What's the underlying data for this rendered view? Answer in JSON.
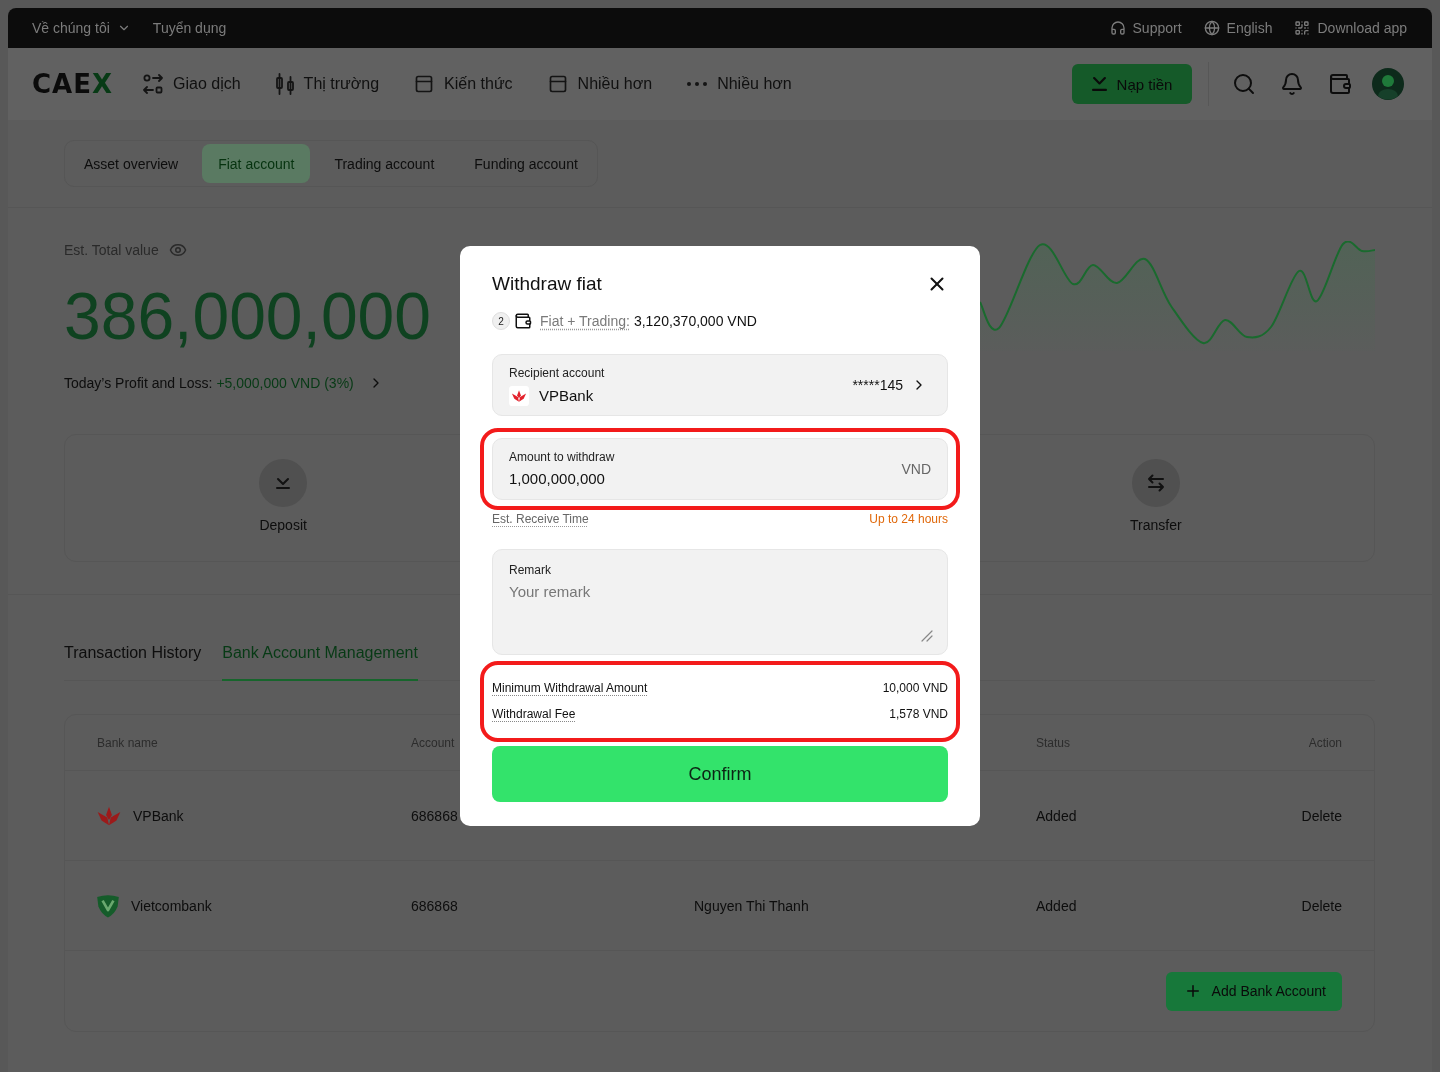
{
  "top_bar": {
    "left": [
      {
        "label": "Về chúng tôi",
        "kind": "menu"
      },
      {
        "label": "Tuyển dụng",
        "kind": "link"
      }
    ],
    "right": [
      "Support",
      "English",
      "Download app"
    ]
  },
  "header": {
    "logo": "CAEX",
    "nav": [
      "Giao dịch",
      "Thị trường",
      "Kiến thức",
      "Nhiều hơn",
      "Nhiều hơn"
    ],
    "deposit_button": "Nạp tiền"
  },
  "account_tabs": [
    {
      "label": "Asset overview",
      "selected": false
    },
    {
      "label": "Fiat account",
      "selected": true
    },
    {
      "label": "Trading account",
      "selected": false
    },
    {
      "label": "Funding account",
      "selected": false
    }
  ],
  "summary": {
    "label": "Est. Total value",
    "total": "386,000,000",
    "pnl_label": "Today’s Profit and Loss:",
    "pnl_value": "+5,000,000 VND (3%)"
  },
  "actions": [
    "Deposit",
    "Transfer"
  ],
  "section_tabs": [
    {
      "label": "Transaction History",
      "selected": false
    },
    {
      "label": "Bank Account Management",
      "selected": true
    }
  ],
  "bank_table": {
    "columns": [
      "Bank name",
      "Account",
      "Status",
      "Action"
    ],
    "rows": [
      {
        "bank_name": "VPBank",
        "account": "686868",
        "status": "Added",
        "action": "Delete"
      },
      {
        "bank_name": "Vietcombank",
        "account": "686868",
        "column_3": "Nguyen Thi Thanh",
        "status": "Added",
        "action": "Delete"
      }
    ],
    "add_button": "Add Bank Account"
  },
  "modal": {
    "title": "Withdraw fiat",
    "balance": {
      "badge": "2",
      "label": "Fiat + Trading:",
      "value": "3,120,370,000 VND"
    },
    "recipient": {
      "label": "Recipient account",
      "bank": "VPBank",
      "account": "*****145"
    },
    "amount": {
      "label": "Amount to withdraw",
      "value": "1,000,000,000",
      "currency": "VND",
      "highlighted": true
    },
    "receive_time": {
      "label": "Est. Receive Time",
      "value": "Up to 24 hours"
    },
    "remark": {
      "label": "Remark",
      "placeholder": "Your remark"
    },
    "limits": {
      "highlighted": true,
      "rows": [
        {
          "label": "Minimum Withdrawal Amount",
          "value": "10,000 VND"
        },
        {
          "label": "Withdrawal Fee",
          "value": "1,578 VND"
        }
      ]
    },
    "confirm": "Confirm"
  }
}
